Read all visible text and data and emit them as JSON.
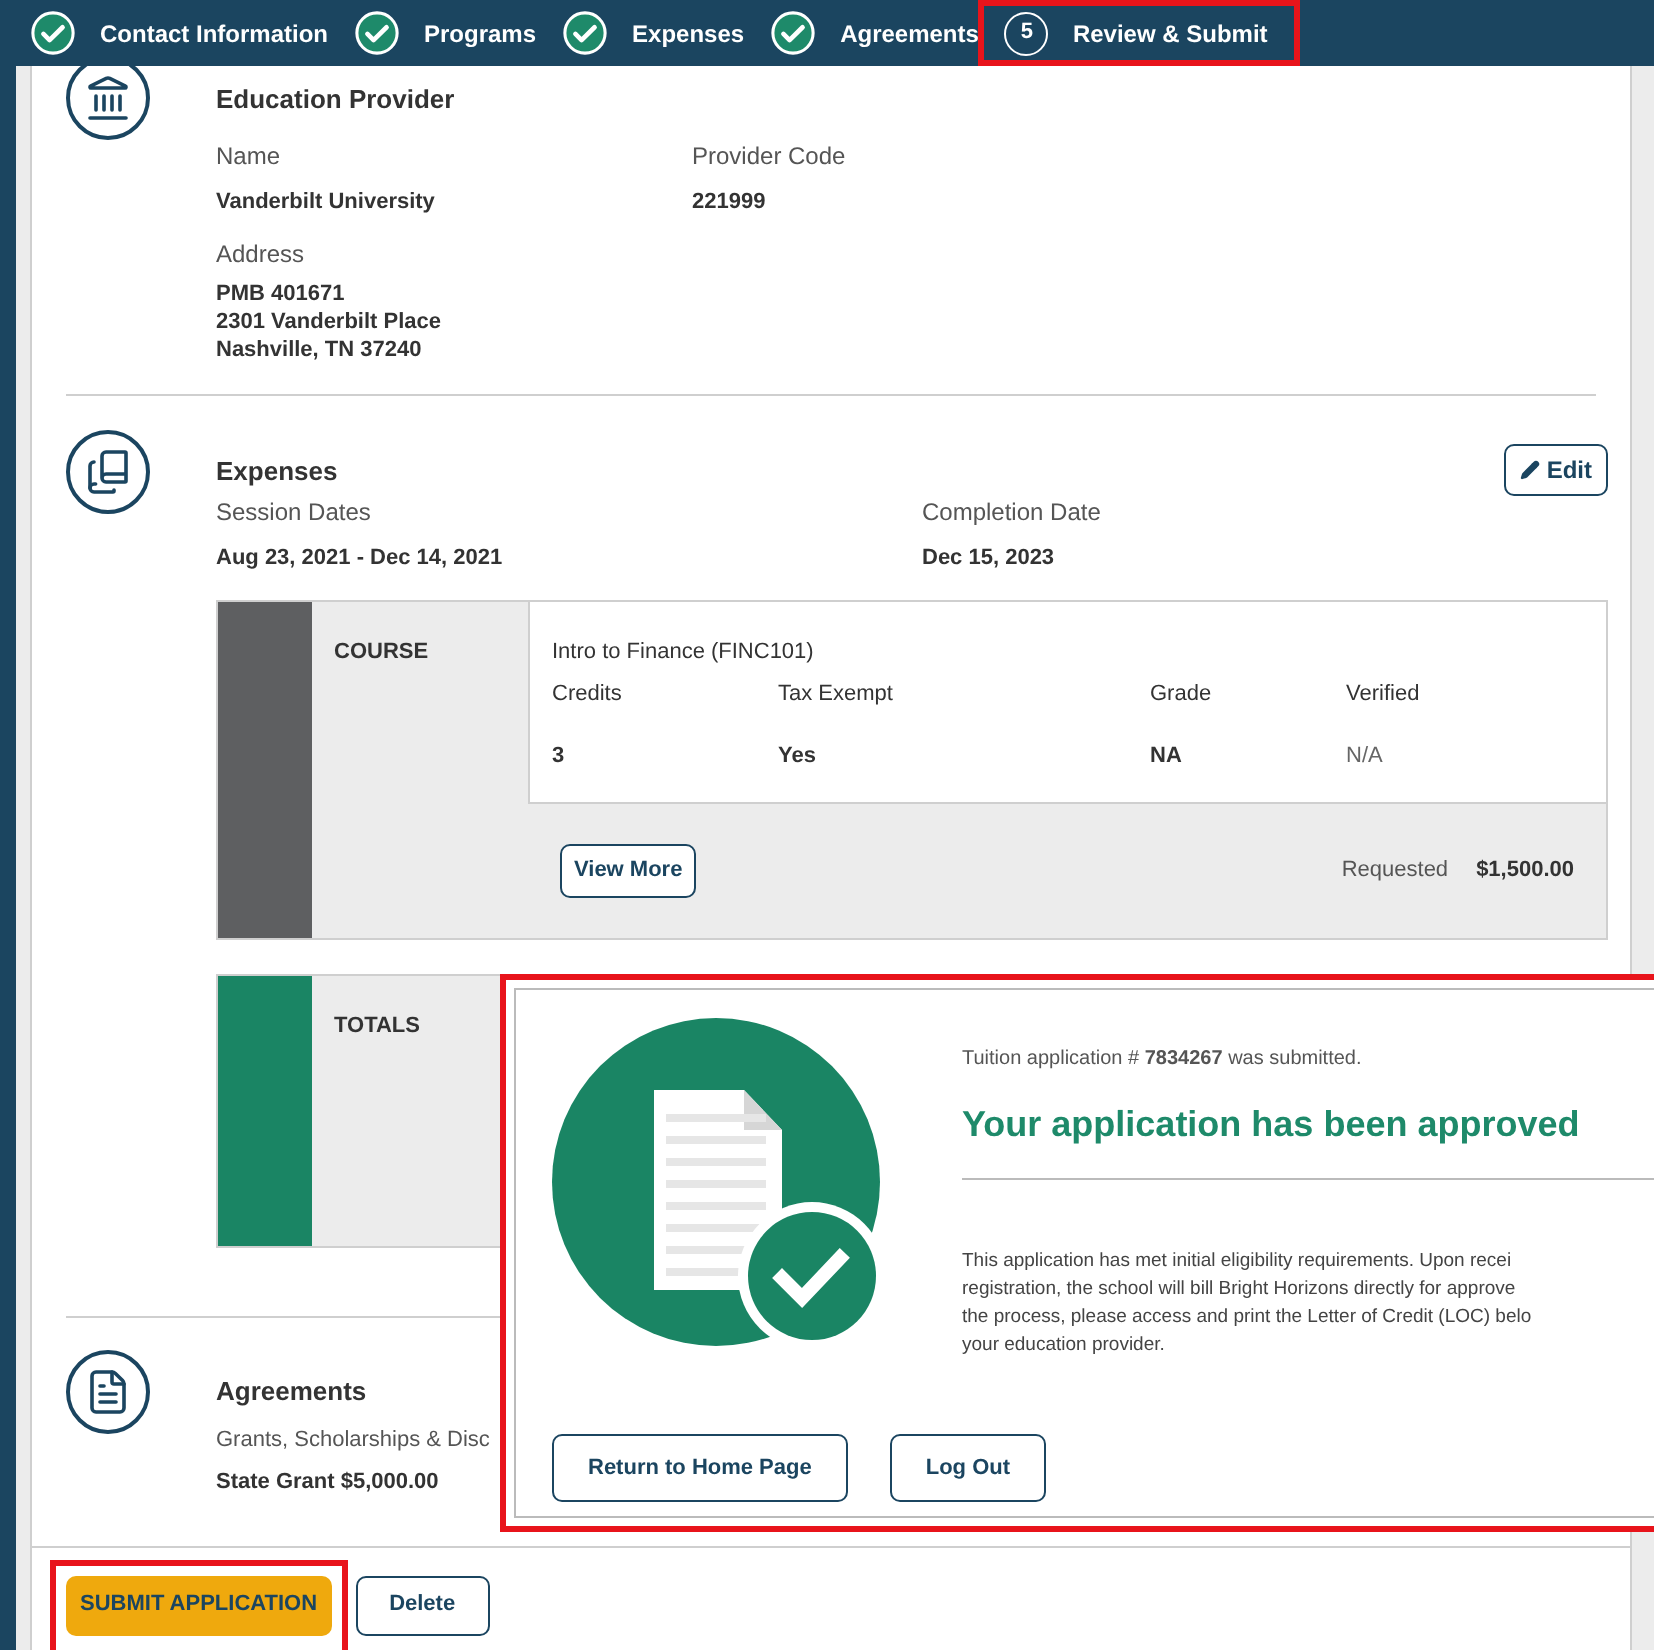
{
  "steps": [
    {
      "label": "Contact Information",
      "kind": "done",
      "highlighted": false
    },
    {
      "label": "Programs",
      "kind": "done",
      "highlighted": false
    },
    {
      "label": "Expenses",
      "kind": "done",
      "highlighted": false
    },
    {
      "label": "Agreements",
      "kind": "done",
      "highlighted": false
    },
    {
      "label": "Review & Submit",
      "kind": "current",
      "number": "5",
      "highlighted": true
    }
  ],
  "provider": {
    "title": "Education Provider",
    "name_label": "Name",
    "name": "Vanderbilt University",
    "code_label": "Provider Code",
    "code": "221999",
    "address_label": "Address",
    "address_lines": [
      "PMB 401671",
      "2301 Vanderbilt Place",
      "Nashville, TN 37240"
    ]
  },
  "expenses": {
    "title": "Expenses",
    "edit_button": "Edit",
    "session_label": "Session Dates",
    "session": "Aug 23, 2021 - Dec 14, 2021",
    "completion_label": "Completion Date",
    "completion": "Dec 15, 2023",
    "course": {
      "label": "COURSE",
      "name": "Intro to Finance (FINC101)",
      "columns": [
        {
          "label": "Credits",
          "value": "3",
          "bold": true
        },
        {
          "label": "Tax Exempt",
          "value": "Yes",
          "bold": true
        },
        {
          "label": "Grade",
          "value": "NA",
          "bold": true
        },
        {
          "label": "Verified",
          "value": "N/A",
          "bold": false
        }
      ],
      "view_more": "View More",
      "requested_label": "Requested",
      "requested": "$1,500.00"
    },
    "totals": {
      "label": "TOTALS"
    }
  },
  "agreements": {
    "title": "Agreements",
    "label": "Grants, Scholarships & Disc",
    "value": "State Grant $5,000.00"
  },
  "footer": {
    "buttons": [
      {
        "label": "SUBMIT APPLICATION",
        "kind": "primary",
        "highlighted": true
      },
      {
        "label": "Delete",
        "kind": "secondary",
        "highlighted": false
      }
    ]
  },
  "popup": {
    "highlighted": true,
    "submitted_text": "Tuition application # **7834267** was submitted.",
    "headline": "Your application has been approved",
    "body_lines": [
      "This application has met initial eligibility requirements. Upon recei",
      "registration, the school will bill Bright Horizons directly for approve",
      "the process, please access and print the Letter of Credit (LOC) belo",
      "your education provider."
    ],
    "buttons": [
      "Return to Home Page",
      "Log Out"
    ]
  }
}
